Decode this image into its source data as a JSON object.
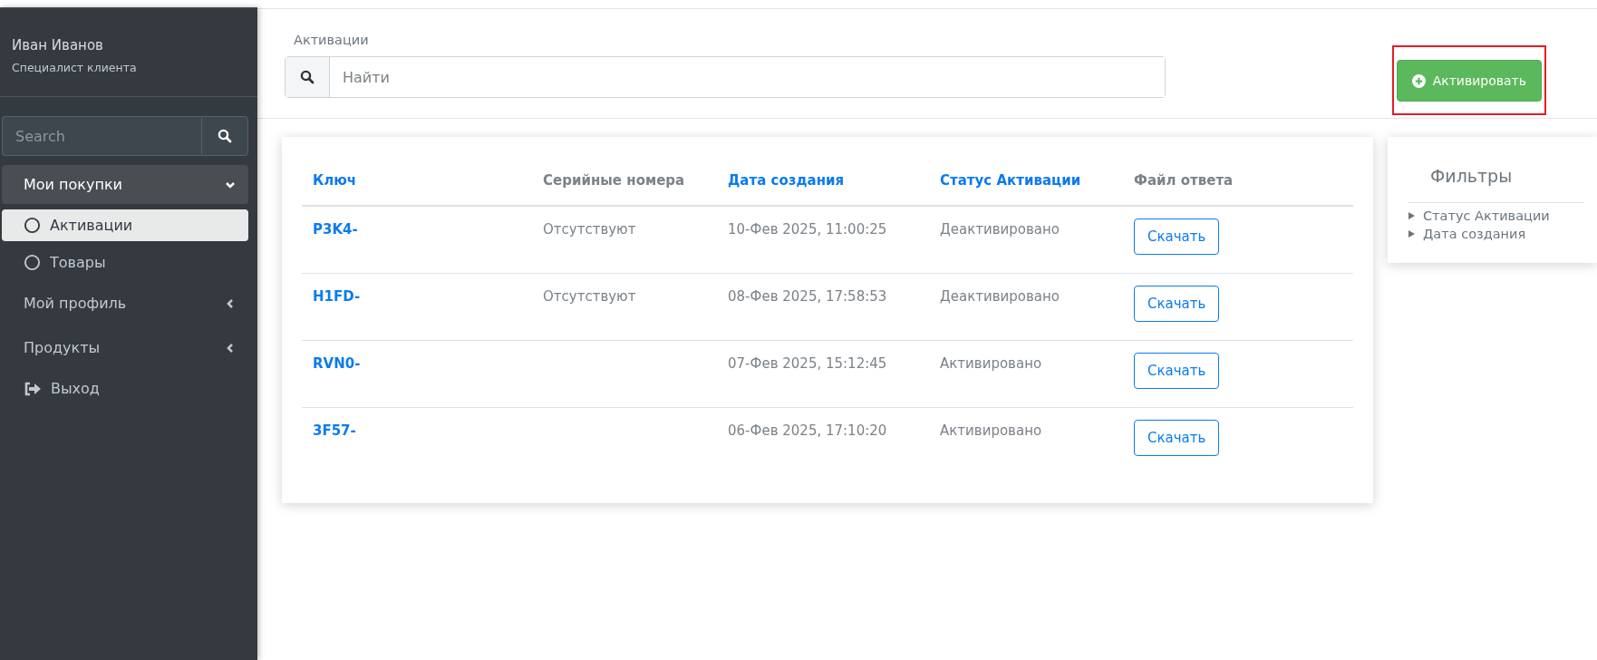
{
  "sidebar": {
    "user": {
      "name": "Иван Иванов",
      "role": "Специалист клиента"
    },
    "search": {
      "placeholder": "Search"
    },
    "items": [
      {
        "kind": "group",
        "label": "Мои покупки",
        "expanded": true,
        "children": [
          {
            "kind": "sub",
            "label": "Активации",
            "selected": true
          },
          {
            "kind": "sub",
            "label": "Товары",
            "selected": false
          }
        ]
      },
      {
        "kind": "group",
        "label": "Мой профиль",
        "expanded": false
      },
      {
        "kind": "group",
        "label": "Продукты",
        "expanded": false
      },
      {
        "kind": "logout",
        "label": "Выход"
      }
    ]
  },
  "header": {
    "title": "Активации",
    "search": {
      "placeholder": "Найти"
    },
    "action": {
      "label": "Активировать",
      "highlighted": true
    }
  },
  "table": {
    "columns": [
      {
        "label": "Ключ",
        "sortable": true
      },
      {
        "label": "Серийные номера",
        "sortable": false
      },
      {
        "label": "Дата создания",
        "sortable": true
      },
      {
        "label": "Статус Активации",
        "sortable": true
      },
      {
        "label": "Файл ответа",
        "sortable": false
      }
    ],
    "rows": [
      {
        "key": "P3K4-",
        "serials": "Отсутствуют",
        "created": "10-Фев 2025, 11:00:25",
        "status": "Деактивировано",
        "file": "Скачать"
      },
      {
        "key": "H1FD-",
        "serials": "Отсутствуют",
        "created": "08-Фев 2025, 17:58:53",
        "status": "Деактивировано",
        "file": "Скачать"
      },
      {
        "key": "RVN0-",
        "created": "07-Фев 2025, 15:12:45",
        "status": "Активировано",
        "file": "Скачать"
      },
      {
        "key": "3F57-",
        "created": "06-Фев 2025, 17:10:20",
        "status": "Активировано",
        "file": "Скачать"
      }
    ]
  },
  "filters": {
    "title": "Фильтры",
    "items": [
      {
        "label": "Статус Активации",
        "expanded": false
      },
      {
        "label": "Дата создания",
        "expanded": false
      }
    ]
  }
}
